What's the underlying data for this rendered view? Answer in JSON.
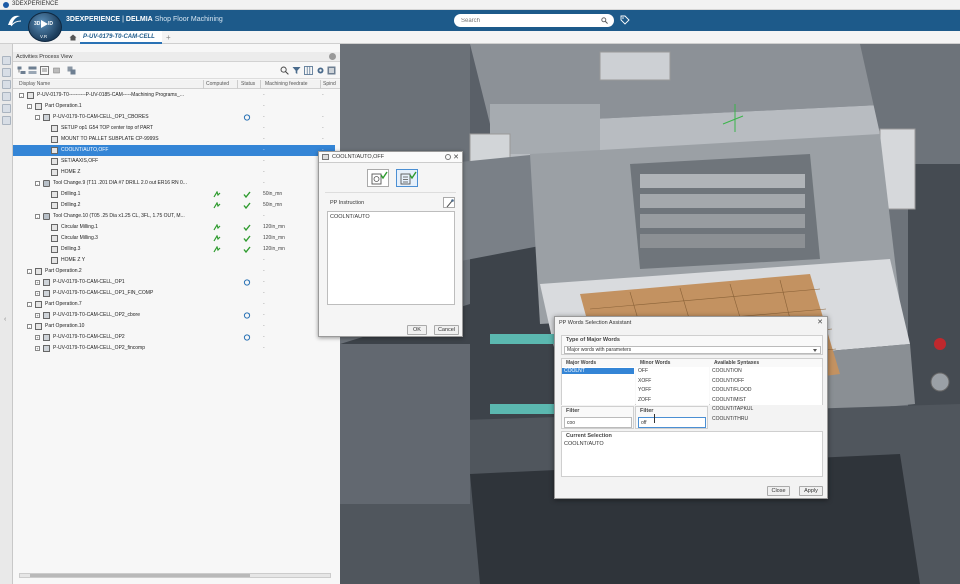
{
  "os": {
    "title": "3DEXPERIENCE"
  },
  "header": {
    "brand": "3DEXPERIENCE",
    "separator": "|",
    "company": "DELMIA",
    "product": "Shop Floor Machining",
    "compass_label": "V.R",
    "search_placeholder": "Search"
  },
  "tabs": {
    "active": "P-UV-0179-T0-CAM-CELL"
  },
  "panel": {
    "title": "Activities Process View",
    "columns": [
      "Display Name",
      "Computed",
      "Status",
      "Machining feedrate",
      "Spind"
    ],
    "rows": [
      {
        "label": "P-UV-0179-T0----------P-UV-0185-CAM-----Machining Programs_...",
        "indent": 0,
        "kind": "root",
        "toggle": "-",
        "computed": "",
        "status": "",
        "feed": "-",
        "spindle": "-"
      },
      {
        "label": "Part Operation.1",
        "indent": 1,
        "kind": "partop",
        "toggle": "-",
        "computed": "",
        "status": "",
        "feed": "-",
        "spindle": ""
      },
      {
        "label": "P-UV-0179-T0-CAM-CELL_OP1_CBORES",
        "indent": 2,
        "kind": "prog",
        "toggle": "-",
        "computed": "",
        "status": "sync",
        "feed": "-",
        "spindle": "-"
      },
      {
        "label": "SETUP op1 G54 TOP center top of PART",
        "indent": 3,
        "kind": "op",
        "toggle": "",
        "computed": "",
        "status": "",
        "feed": "-",
        "spindle": "-"
      },
      {
        "label": "MOUNT TO PALLET SUBPLATE CP-9999S",
        "indent": 3,
        "kind": "op",
        "toggle": "",
        "computed": "",
        "status": "",
        "feed": "-",
        "spindle": "-"
      },
      {
        "label": "COOLNT/AUTO,OFF",
        "indent": 3,
        "kind": "op",
        "toggle": "",
        "computed": "",
        "status": "",
        "feed": "-",
        "spindle": "-",
        "selected": true
      },
      {
        "label": "SET/AAXIS,OFF",
        "indent": 3,
        "kind": "op",
        "toggle": "",
        "computed": "",
        "status": "",
        "feed": "-",
        "spindle": ""
      },
      {
        "label": "HOME Z",
        "indent": 3,
        "kind": "op",
        "toggle": "",
        "computed": "",
        "status": "",
        "feed": "-",
        "spindle": ""
      },
      {
        "label": "Tool Change.9 (T11 .201 DIA #7 DRILL 2.0 out ER16 RN 0...",
        "indent": 2,
        "kind": "tool",
        "toggle": "-",
        "computed": "",
        "status": "",
        "feed": "-",
        "spindle": ""
      },
      {
        "label": "Drilling.1",
        "indent": 3,
        "kind": "op",
        "toggle": "",
        "computed": "done",
        "status": "check",
        "feed": "50in_mn",
        "spindle": ""
      },
      {
        "label": "Drilling.2",
        "indent": 3,
        "kind": "op",
        "toggle": "",
        "computed": "done",
        "status": "check",
        "feed": "50in_mn",
        "spindle": ""
      },
      {
        "label": "Tool Change.10 (T05 .25 Dia x1.25 CL, 3FL, 1.75 OUT, M...",
        "indent": 2,
        "kind": "tool",
        "toggle": "-",
        "computed": "",
        "status": "",
        "feed": "-",
        "spindle": ""
      },
      {
        "label": "Circular Milling.1",
        "indent": 3,
        "kind": "op",
        "toggle": "",
        "computed": "done",
        "status": "check",
        "feed": "120in_mn",
        "spindle": ""
      },
      {
        "label": "Circular Milling.3",
        "indent": 3,
        "kind": "op",
        "toggle": "",
        "computed": "done",
        "status": "check",
        "feed": "120in_mn",
        "spindle": ""
      },
      {
        "label": "Drilling.3",
        "indent": 3,
        "kind": "op",
        "toggle": "",
        "computed": "done",
        "status": "check",
        "feed": "120in_mn",
        "spindle": ""
      },
      {
        "label": "HOME Z Y",
        "indent": 3,
        "kind": "op",
        "toggle": "",
        "computed": "",
        "status": "",
        "feed": "-",
        "spindle": ""
      },
      {
        "label": "Part Operation.2",
        "indent": 1,
        "kind": "partop",
        "toggle": "-",
        "computed": "",
        "status": "",
        "feed": "-",
        "spindle": ""
      },
      {
        "label": "P-UV-0179-T0-CAM-CELL_OP1",
        "indent": 2,
        "kind": "prog",
        "toggle": "+",
        "computed": "",
        "status": "sync",
        "feed": "-",
        "spindle": ""
      },
      {
        "label": "P-UV-0179-T0-CAM-CELL_OP1_FIN_COMP",
        "indent": 2,
        "kind": "prog",
        "toggle": "+",
        "computed": "",
        "status": "",
        "feed": "-",
        "spindle": ""
      },
      {
        "label": "Part Operation.7",
        "indent": 1,
        "kind": "partop",
        "toggle": "-",
        "computed": "",
        "status": "",
        "feed": "-",
        "spindle": ""
      },
      {
        "label": "P-UV-0179-T0-CAM-CELL_OP2_cbore",
        "indent": 2,
        "kind": "prog",
        "toggle": "+",
        "computed": "",
        "status": "sync",
        "feed": "-",
        "spindle": ""
      },
      {
        "label": "Part Operation.10",
        "indent": 1,
        "kind": "partop",
        "toggle": "-",
        "computed": "",
        "status": "",
        "feed": "-",
        "spindle": ""
      },
      {
        "label": "P-UV-0179-T0-CAM-CELL_OP2",
        "indent": 2,
        "kind": "prog",
        "toggle": "+",
        "computed": "",
        "status": "sync",
        "feed": "-",
        "spindle": ""
      },
      {
        "label": "P-UV-0179-T0-CAM-CELL_OP2_fincomp",
        "indent": 2,
        "kind": "prog",
        "toggle": "+",
        "computed": "",
        "status": "",
        "feed": "-",
        "spindle": ""
      }
    ]
  },
  "pp_dialog": {
    "title": "COOLNT/AUTO,OFF",
    "section_label": "PP Instruction",
    "instruction": "COOLNT/AUTO",
    "ok": "OK",
    "cancel": "Cancel"
  },
  "ppw_dialog": {
    "title": "PP Words Selection Assistant",
    "type_label": "Type of Major Words",
    "type_value": "Major words with parameters",
    "major_label": "Major Words",
    "minor_label": "Minor Words",
    "syntax_label": "Available Syntaxes",
    "major_words": [
      "COOLNT"
    ],
    "minor_words": [
      "OFF",
      "XOFF",
      "YOFF",
      "ZOFF"
    ],
    "syntaxes": [
      "COOLNT/ON",
      "COOLNT/OFF",
      "COOLNT/FLOOD",
      "COOLNT/MIST",
      "COOLNT/TAPKUL",
      "COOLNT/THRU"
    ],
    "filter_label": "Filter",
    "filter_major_value": "coo",
    "filter_minor_value": "off",
    "current_label": "Current Selection",
    "current_value": "COOLNT/AUTO",
    "close": "Close",
    "apply": "Apply"
  },
  "colors": {
    "header_bg": "#1d5a8a",
    "selection": "#3485d6",
    "check_green": "#2e9b2e",
    "viewport_bg": "#3a4048",
    "pallet": "#c0905a",
    "teal": "#5bb8b0"
  }
}
